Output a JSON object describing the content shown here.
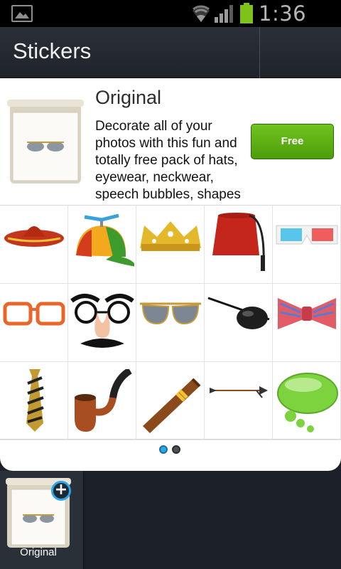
{
  "status_bar": {
    "time": "1:36 PM",
    "icons": [
      "gallery-icon",
      "wifi-icon",
      "signal-icon",
      "battery-icon"
    ]
  },
  "action_bar": {
    "title": "Stickers"
  },
  "pack": {
    "name": "Original",
    "description": "Decorate all of your photos with this fun and totally free pack of hats, eyewear, neckwear, speech bubbles, shapes",
    "price_label": "Free",
    "accent_color": "#5aae14"
  },
  "stickers": [
    {
      "name": "sombrero-sticker-icon"
    },
    {
      "name": "propeller-cap-sticker-icon"
    },
    {
      "name": "crown-sticker-icon"
    },
    {
      "name": "fez-sticker-icon"
    },
    {
      "name": "3d-glasses-sticker-icon"
    },
    {
      "name": "orange-glasses-sticker-icon"
    },
    {
      "name": "groucho-disguise-sticker-icon"
    },
    {
      "name": "aviator-sunglasses-sticker-icon"
    },
    {
      "name": "eye-patch-sticker-icon"
    },
    {
      "name": "bow-tie-sticker-icon"
    },
    {
      "name": "striped-tie-sticker-icon"
    },
    {
      "name": "pipe-sticker-icon"
    },
    {
      "name": "cigar-sticker-icon"
    },
    {
      "name": "arrow-sticker-icon"
    },
    {
      "name": "speech-bubble-sticker-icon"
    }
  ],
  "pager": {
    "pages": 2,
    "current": 1
  },
  "tray": {
    "items": [
      {
        "label": "Original",
        "badge_icon": "add-icon"
      }
    ]
  }
}
